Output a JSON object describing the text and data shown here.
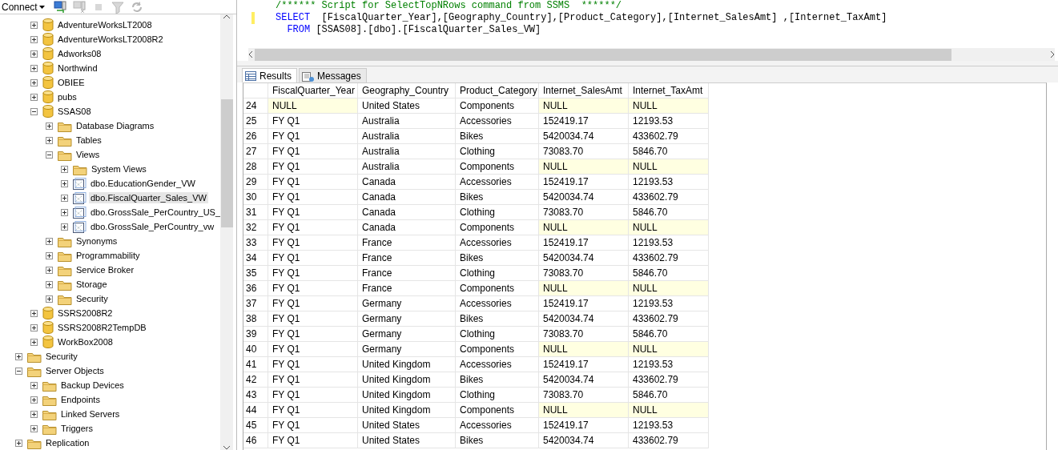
{
  "toolbar": {
    "connect_label": "Connect",
    "buttons": [
      {
        "kind": "connect",
        "disabled": false
      },
      {
        "kind": "disconnect",
        "disabled": true
      },
      {
        "kind": "stop",
        "disabled": true
      },
      {
        "kind": "filter",
        "disabled": true
      },
      {
        "kind": "refresh",
        "disabled": true
      }
    ]
  },
  "tree": {
    "database_nodes": [
      {
        "label": "AdventureWorksLT2008",
        "kind": "database",
        "expanded": false,
        "selected": false
      },
      {
        "label": "AdventureWorksLT2008R2",
        "kind": "database",
        "expanded": false,
        "selected": false
      },
      {
        "label": "Adworks08",
        "kind": "database",
        "expanded": false,
        "selected": false
      },
      {
        "label": "Northwind",
        "kind": "database",
        "expanded": false,
        "selected": false
      },
      {
        "label": "OBIEE",
        "kind": "database",
        "expanded": false,
        "selected": false
      },
      {
        "label": "pubs",
        "kind": "database",
        "expanded": false,
        "selected": false
      },
      {
        "label": "SSAS08",
        "kind": "database",
        "expanded": true,
        "selected": false,
        "children": [
          {
            "label": "Database Diagrams",
            "kind": "folder",
            "expanded": false,
            "selected": false
          },
          {
            "label": "Tables",
            "kind": "folder",
            "expanded": false,
            "selected": false
          },
          {
            "label": "Views",
            "kind": "folder",
            "expanded": true,
            "selected": false,
            "children": [
              {
                "label": "System Views",
                "kind": "folder",
                "expanded": false,
                "selected": false
              },
              {
                "label": "dbo.EducationGender_VW",
                "kind": "view",
                "expanded": false,
                "selected": false
              },
              {
                "label": "dbo.FiscalQuarter_Sales_VW",
                "kind": "view",
                "expanded": false,
                "selected": true
              },
              {
                "label": "dbo.GrossSale_PerCountry_US_",
                "kind": "view",
                "expanded": false,
                "selected": false
              },
              {
                "label": "dbo.GrossSale_PerCountry_vw",
                "kind": "view",
                "expanded": false,
                "selected": false
              }
            ]
          },
          {
            "label": "Synonyms",
            "kind": "folder",
            "expanded": false,
            "selected": false
          },
          {
            "label": "Programmability",
            "kind": "folder",
            "expanded": false,
            "selected": false
          },
          {
            "label": "Service Broker",
            "kind": "folder",
            "expanded": false,
            "selected": false
          },
          {
            "label": "Storage",
            "kind": "folder",
            "expanded": false,
            "selected": false
          },
          {
            "label": "Security",
            "kind": "folder",
            "expanded": false,
            "selected": false
          }
        ]
      },
      {
        "label": "SSRS2008R2",
        "kind": "database",
        "expanded": false,
        "selected": false
      },
      {
        "label": "SSRS2008R2TempDB",
        "kind": "database",
        "expanded": false,
        "selected": false
      },
      {
        "label": "WorkBox2008",
        "kind": "database",
        "expanded": false,
        "selected": false
      }
    ],
    "server_nodes": [
      {
        "label": "Security",
        "kind": "folder",
        "expanded": false,
        "selected": false
      },
      {
        "label": "Server Objects",
        "kind": "folder",
        "expanded": true,
        "selected": false,
        "children": [
          {
            "label": "Backup Devices",
            "kind": "folder",
            "expanded": false,
            "selected": false
          },
          {
            "label": "Endpoints",
            "kind": "folder",
            "expanded": false,
            "selected": false
          },
          {
            "label": "Linked Servers",
            "kind": "folder",
            "expanded": false,
            "selected": false
          },
          {
            "label": "Triggers",
            "kind": "folder",
            "expanded": false,
            "selected": false
          }
        ]
      },
      {
        "label": "Replication",
        "kind": "folder",
        "expanded": false,
        "selected": false
      }
    ]
  },
  "editor": {
    "lines": [
      {
        "changed": false,
        "tokens": [
          {
            "kind": "comment",
            "text": "/****** Script for SelectTopNRows command from SSMS  ******/"
          }
        ]
      },
      {
        "changed": true,
        "tokens": [
          {
            "kind": "keyword",
            "text": "SELECT"
          },
          {
            "kind": "plain",
            "text": "  [FiscalQuarter_Year],[Geography_Country],[Product_Category],[Internet_SalesAmt] ,[Internet_TaxAmt]"
          }
        ]
      },
      {
        "changed": false,
        "tokens": [
          {
            "kind": "keyword",
            "text": "  FROM"
          },
          {
            "kind": "plain",
            "text": " [SSAS08].[dbo].[FiscalQuarter_Sales_VW]"
          }
        ]
      }
    ]
  },
  "result_tabs": [
    {
      "label": "Results",
      "kind": "grid",
      "selected": true
    },
    {
      "label": "Messages",
      "kind": "messages",
      "selected": false
    }
  ],
  "grid": {
    "columns": [
      "FiscalQuarter_Year",
      "Geography_Country",
      "Product_Category",
      "Internet_SalesAmt",
      "Internet_TaxAmt"
    ],
    "rows": [
      {
        "number": "24",
        "cells": [
          "NULL",
          "United States",
          "Components",
          "NULL",
          "NULL"
        ],
        "null_flags": [
          true,
          false,
          false,
          true,
          true
        ]
      },
      {
        "number": "25",
        "cells": [
          "FY Q1",
          "Australia",
          "Accessories",
          "152419.17",
          "12193.53"
        ],
        "null_flags": [
          false,
          false,
          false,
          false,
          false
        ]
      },
      {
        "number": "26",
        "cells": [
          "FY Q1",
          "Australia",
          "Bikes",
          "5420034.74",
          "433602.79"
        ],
        "null_flags": [
          false,
          false,
          false,
          false,
          false
        ]
      },
      {
        "number": "27",
        "cells": [
          "FY Q1",
          "Australia",
          "Clothing",
          "73083.70",
          "5846.70"
        ],
        "null_flags": [
          false,
          false,
          false,
          false,
          false
        ]
      },
      {
        "number": "28",
        "cells": [
          "FY Q1",
          "Australia",
          "Components",
          "NULL",
          "NULL"
        ],
        "null_flags": [
          false,
          false,
          false,
          true,
          true
        ]
      },
      {
        "number": "29",
        "cells": [
          "FY Q1",
          "Canada",
          "Accessories",
          "152419.17",
          "12193.53"
        ],
        "null_flags": [
          false,
          false,
          false,
          false,
          false
        ]
      },
      {
        "number": "30",
        "cells": [
          "FY Q1",
          "Canada",
          "Bikes",
          "5420034.74",
          "433602.79"
        ],
        "null_flags": [
          false,
          false,
          false,
          false,
          false
        ]
      },
      {
        "number": "31",
        "cells": [
          "FY Q1",
          "Canada",
          "Clothing",
          "73083.70",
          "5846.70"
        ],
        "null_flags": [
          false,
          false,
          false,
          false,
          false
        ]
      },
      {
        "number": "32",
        "cells": [
          "FY Q1",
          "Canada",
          "Components",
          "NULL",
          "NULL"
        ],
        "null_flags": [
          false,
          false,
          false,
          true,
          true
        ]
      },
      {
        "number": "33",
        "cells": [
          "FY Q1",
          "France",
          "Accessories",
          "152419.17",
          "12193.53"
        ],
        "null_flags": [
          false,
          false,
          false,
          false,
          false
        ]
      },
      {
        "number": "34",
        "cells": [
          "FY Q1",
          "France",
          "Bikes",
          "5420034.74",
          "433602.79"
        ],
        "null_flags": [
          false,
          false,
          false,
          false,
          false
        ]
      },
      {
        "number": "35",
        "cells": [
          "FY Q1",
          "France",
          "Clothing",
          "73083.70",
          "5846.70"
        ],
        "null_flags": [
          false,
          false,
          false,
          false,
          false
        ]
      },
      {
        "number": "36",
        "cells": [
          "FY Q1",
          "France",
          "Components",
          "NULL",
          "NULL"
        ],
        "null_flags": [
          false,
          false,
          false,
          true,
          true
        ]
      },
      {
        "number": "37",
        "cells": [
          "FY Q1",
          "Germany",
          "Accessories",
          "152419.17",
          "12193.53"
        ],
        "null_flags": [
          false,
          false,
          false,
          false,
          false
        ]
      },
      {
        "number": "38",
        "cells": [
          "FY Q1",
          "Germany",
          "Bikes",
          "5420034.74",
          "433602.79"
        ],
        "null_flags": [
          false,
          false,
          false,
          false,
          false
        ]
      },
      {
        "number": "39",
        "cells": [
          "FY Q1",
          "Germany",
          "Clothing",
          "73083.70",
          "5846.70"
        ],
        "null_flags": [
          false,
          false,
          false,
          false,
          false
        ]
      },
      {
        "number": "40",
        "cells": [
          "FY Q1",
          "Germany",
          "Components",
          "NULL",
          "NULL"
        ],
        "null_flags": [
          false,
          false,
          false,
          true,
          true
        ]
      },
      {
        "number": "41",
        "cells": [
          "FY Q1",
          "United Kingdom",
          "Accessories",
          "152419.17",
          "12193.53"
        ],
        "null_flags": [
          false,
          false,
          false,
          false,
          false
        ]
      },
      {
        "number": "42",
        "cells": [
          "FY Q1",
          "United Kingdom",
          "Bikes",
          "5420034.74",
          "433602.79"
        ],
        "null_flags": [
          false,
          false,
          false,
          false,
          false
        ]
      },
      {
        "number": "43",
        "cells": [
          "FY Q1",
          "United Kingdom",
          "Clothing",
          "73083.70",
          "5846.70"
        ],
        "null_flags": [
          false,
          false,
          false,
          false,
          false
        ]
      },
      {
        "number": "44",
        "cells": [
          "FY Q1",
          "United Kingdom",
          "Components",
          "NULL",
          "NULL"
        ],
        "null_flags": [
          false,
          false,
          false,
          true,
          true
        ]
      },
      {
        "number": "45",
        "cells": [
          "FY Q1",
          "United States",
          "Accessories",
          "152419.17",
          "12193.53"
        ],
        "null_flags": [
          false,
          false,
          false,
          false,
          false
        ]
      },
      {
        "number": "46",
        "cells": [
          "FY Q1",
          "United States",
          "Bikes",
          "5420034.74",
          "433602.79"
        ],
        "null_flags": [
          false,
          false,
          false,
          false,
          false
        ]
      }
    ]
  }
}
